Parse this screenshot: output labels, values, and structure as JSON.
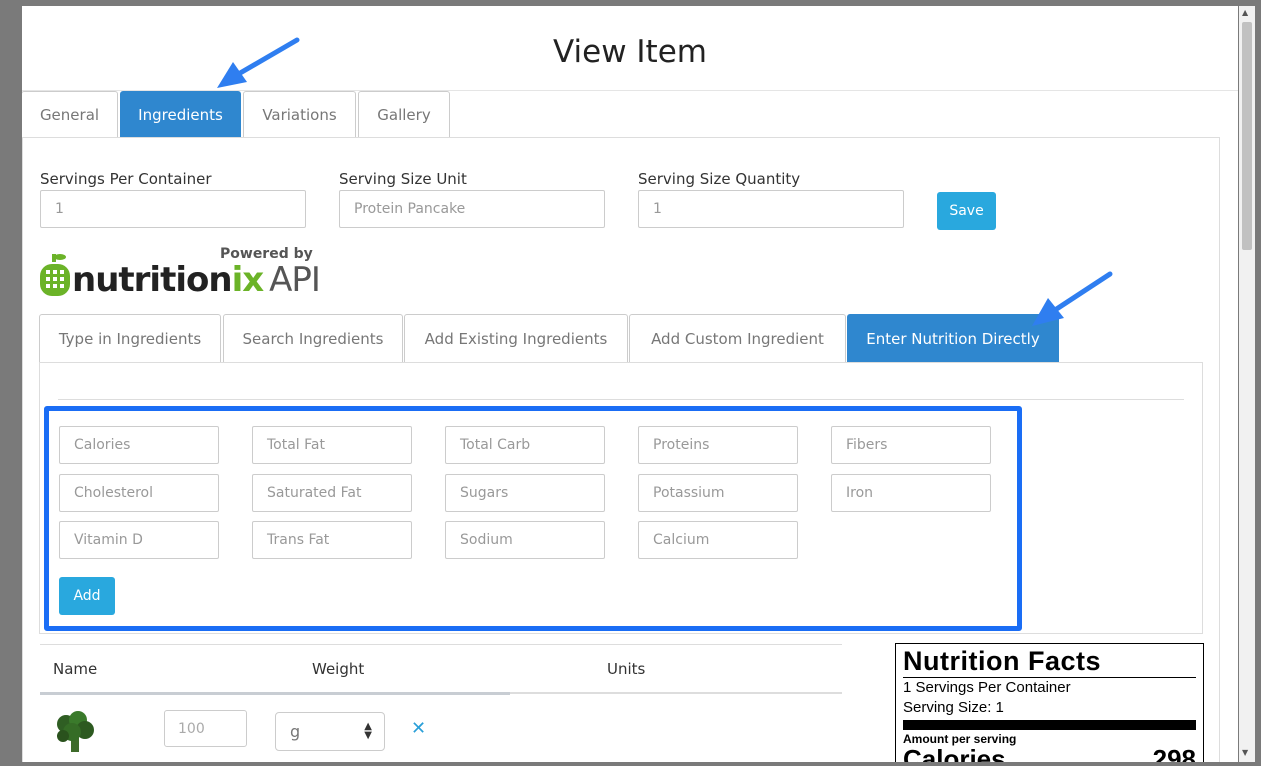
{
  "modal": {
    "title": "View Item",
    "tabs": [
      "General",
      "Ingredients",
      "Variations",
      "Gallery"
    ],
    "active_tab": "Ingredients"
  },
  "serving": {
    "per_container_label": "Servings Per Container",
    "per_container_value": "1",
    "unit_label": "Serving Size Unit",
    "unit_value": "Protein Pancake",
    "quantity_label": "Serving Size Quantity",
    "quantity_value": "1",
    "save_label": "Save"
  },
  "logo": {
    "powered_by": "Powered by",
    "brand_main": "nutrition",
    "brand_ix": "ix",
    "brand_api": "API"
  },
  "subtabs": [
    "Type in Ingredients",
    "Search Ingredients",
    "Add Existing Ingredients",
    "Add Custom Ingredient",
    "Enter Nutrition Directly"
  ],
  "active_subtab": "Enter Nutrition Directly",
  "nutrient_fields": [
    [
      "Calories",
      "Total Fat",
      "Total Carb",
      "Proteins",
      "Fibers"
    ],
    [
      "Cholesterol",
      "Saturated Fat",
      "Sugars",
      "Potassium",
      "Iron"
    ],
    [
      "Vitamin D",
      "Trans Fat",
      "Sodium",
      "Calcium"
    ]
  ],
  "add_label": "Add",
  "table": {
    "headers": [
      "Name",
      "Weight",
      "Units"
    ],
    "rows": [
      {
        "weight_placeholder": "100",
        "unit": "g"
      }
    ]
  },
  "nutrition_facts": {
    "title": "Nutrition Facts",
    "servings_line": "1 Servings Per Container",
    "size_line": "Serving Size: 1",
    "amount_label": "Amount per serving",
    "calories_label": "Calories",
    "calories_value": "298"
  },
  "colors": {
    "accent": "#2f87cf",
    "button": "#29a8de",
    "highlight": "#1a6df5",
    "brand_green": "#6bb328"
  }
}
